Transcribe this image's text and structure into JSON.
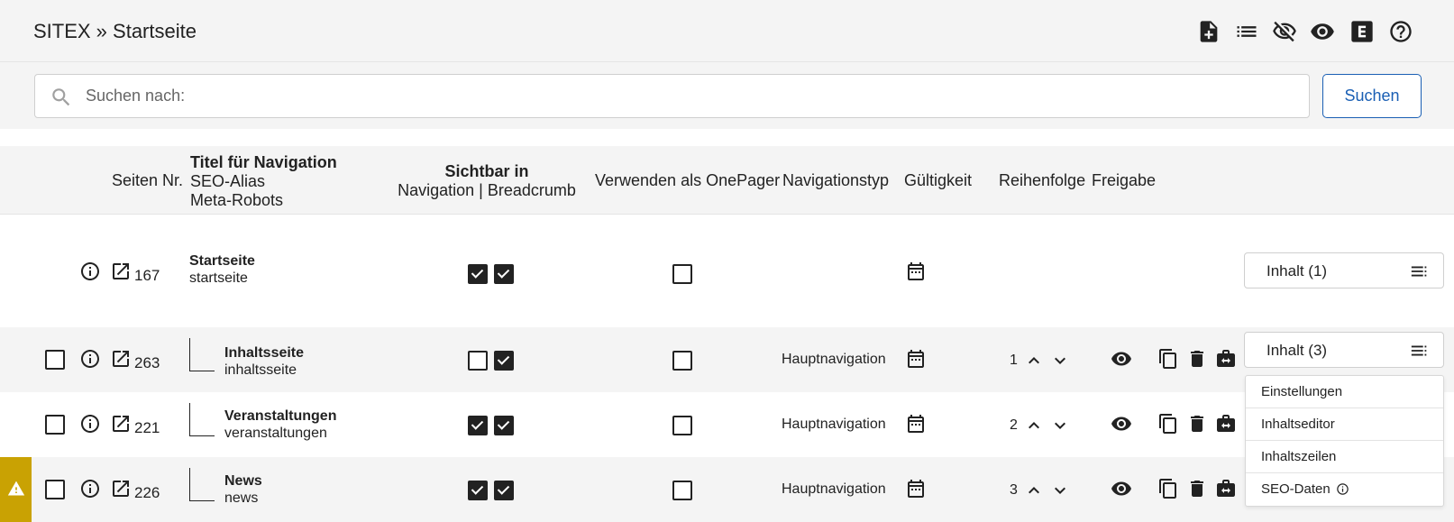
{
  "breadcrumb": "SITEX » Startseite",
  "toolbar": {
    "icons": [
      "add-page-icon",
      "list-icon",
      "visibility-off-icon",
      "visibility-icon",
      "e-icon",
      "help-icon"
    ]
  },
  "search": {
    "placeholder": "Suchen nach:",
    "value": "",
    "button_label": "Suchen"
  },
  "table": {
    "headers": {
      "page_nr": "Seiten Nr.",
      "title_line1": "Titel für Navigation",
      "title_line2": "SEO-Alias",
      "title_line3": "Meta-Robots",
      "visible_line1": "Sichtbar in",
      "visible_line2": "Navigation | Breadcrumb",
      "onepager": "Verwenden als OnePager",
      "navtype": "Navigationstyp",
      "validity": "Gültigkeit",
      "order": "Reihenfolge",
      "release": "Freigabe"
    },
    "rows": [
      {
        "page_nr": "167",
        "title": "Startseite",
        "alias": "startseite",
        "nav_visible": true,
        "breadcrumb_visible": true,
        "onepager": false,
        "navtype": "",
        "order": "",
        "content_button": "Inhalt (1)"
      },
      {
        "page_nr": "263",
        "title": "Inhaltsseite",
        "alias": "inhaltsseite",
        "nav_visible": false,
        "breadcrumb_visible": true,
        "onepager": false,
        "navtype": "Hauptnavigation",
        "order": "1",
        "content_button": "Inhalt (3)"
      },
      {
        "page_nr": "221",
        "title": "Veranstaltungen",
        "alias": "veranstaltungen",
        "nav_visible": true,
        "breadcrumb_visible": true,
        "onepager": false,
        "navtype": "Hauptnavigation",
        "order": "2"
      },
      {
        "page_nr": "226",
        "title": "News",
        "alias": "news",
        "nav_visible": true,
        "breadcrumb_visible": true,
        "onepager": false,
        "navtype": "Hauptnavigation",
        "order": "3",
        "warning": true
      }
    ]
  },
  "dropdown_menu": {
    "items": [
      "Einstellungen",
      "Inhaltseditor",
      "Inhaltszeilen",
      "SEO-Daten"
    ]
  },
  "colors": {
    "accent": "#1a5fb4",
    "warning": "#c9a203",
    "header_bg": "#f4f4f4"
  }
}
